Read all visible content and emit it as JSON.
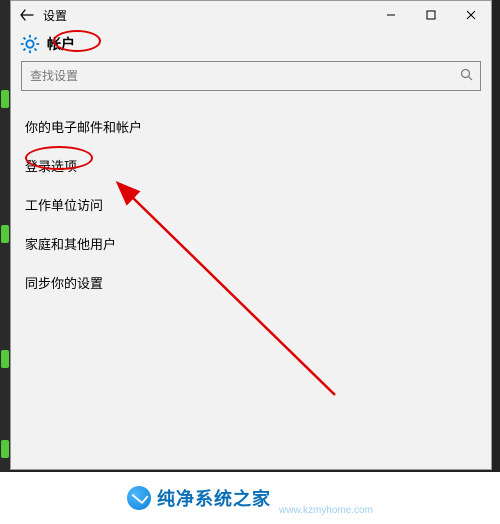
{
  "window": {
    "title": "设置",
    "header": "帐户"
  },
  "search": {
    "placeholder": "查找设置"
  },
  "menu": {
    "items": [
      "你的电子邮件和帐户",
      "登录选项",
      "工作单位访问",
      "家庭和其他用户",
      "同步你的设置"
    ]
  },
  "watermark": {
    "brand_zh": "纯净系统之家",
    "brand_en": "www.kzmyhome.com"
  }
}
